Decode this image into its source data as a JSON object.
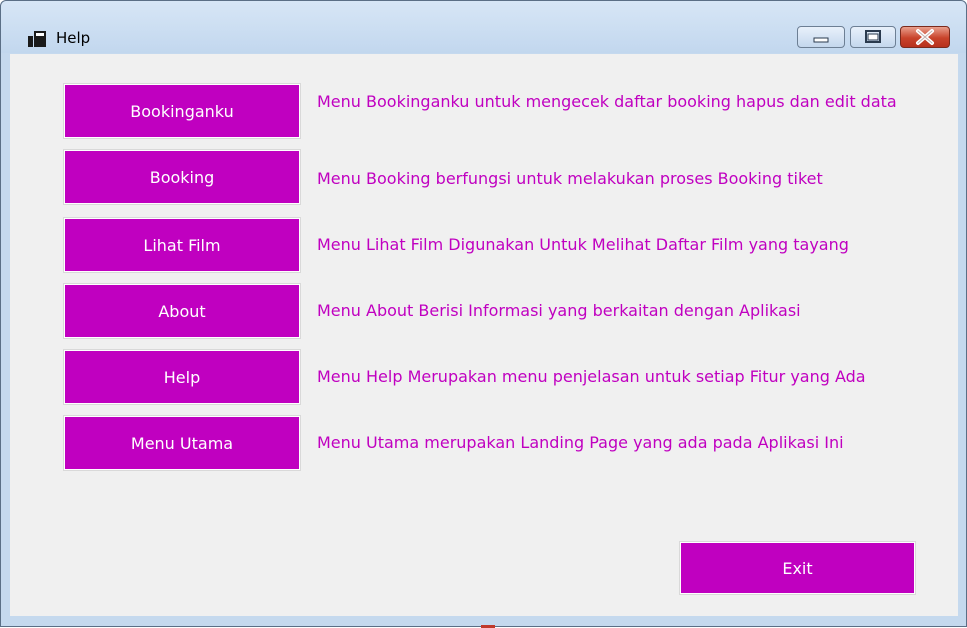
{
  "window": {
    "title": "Help"
  },
  "menu_rows": [
    {
      "button": "Bookinganku",
      "description": "Menu Bookinganku untuk mengecek daftar booking hapus dan edit data"
    },
    {
      "button": "Booking",
      "description": "Menu Booking berfungsi untuk melakukan proses Booking tiket"
    },
    {
      "button": "Lihat Film",
      "description": "Menu Lihat Film Digunakan Untuk Melihat Daftar Film yang tayang"
    },
    {
      "button": "About",
      "description": "Menu About Berisi Informasi yang berkaitan dengan Aplikasi"
    },
    {
      "button": "Help",
      "description": "Menu Help Merupakan menu penjelasan untuk setiap Fitur yang Ada"
    },
    {
      "button": "Menu Utama",
      "description": "Menu Utama merupakan Landing Page yang ada pada Aplikasi Ini"
    }
  ],
  "exit_label": "Exit",
  "colors": {
    "accent": "#c000c0",
    "client_bg": "#f0f0f0",
    "frame": "#c5d9ee",
    "close_button": "#c8432b"
  },
  "icons": {
    "app": "app-window-icon",
    "minimize": "minimize-icon",
    "maximize": "maximize-icon",
    "close": "close-icon"
  }
}
